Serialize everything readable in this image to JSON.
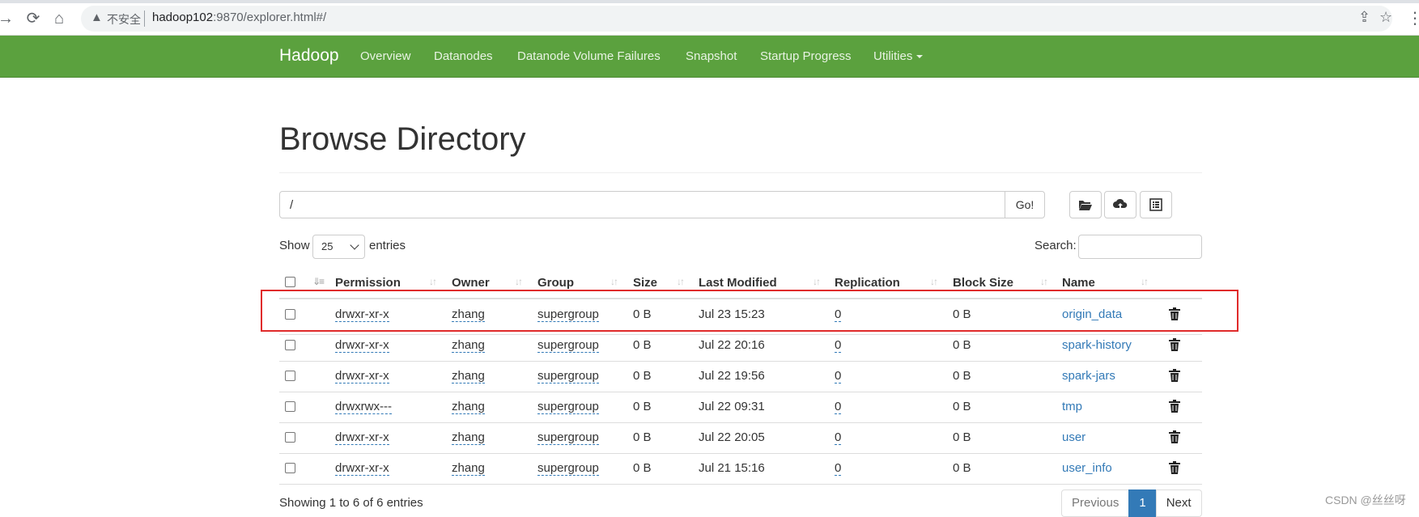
{
  "browser": {
    "insecure_label": "不安全",
    "url_host": "hadoop102",
    "url_rest": ":9870/explorer.html#/"
  },
  "navbar": {
    "brand": "Hadoop",
    "links": [
      "Overview",
      "Datanodes",
      "Datanode Volume Failures",
      "Snapshot",
      "Startup Progress",
      "Utilities"
    ]
  },
  "page": {
    "title": "Browse Directory",
    "path_value": "/",
    "go_label": "Go!",
    "show_label": "Show",
    "page_length": "25",
    "entries_label": "entries",
    "search_label": "Search:",
    "search_value": ""
  },
  "table": {
    "headers": [
      "Permission",
      "Owner",
      "Group",
      "Size",
      "Last Modified",
      "Replication",
      "Block Size",
      "Name"
    ],
    "rows": [
      {
        "permission": "drwxr-xr-x",
        "owner": "zhang",
        "group": "supergroup",
        "size": "0 B",
        "modified": "Jul 23 15:23",
        "replication": "0",
        "block_size": "0 B",
        "name": "origin_data"
      },
      {
        "permission": "drwxr-xr-x",
        "owner": "zhang",
        "group": "supergroup",
        "size": "0 B",
        "modified": "Jul 22 20:16",
        "replication": "0",
        "block_size": "0 B",
        "name": "spark-history"
      },
      {
        "permission": "drwxr-xr-x",
        "owner": "zhang",
        "group": "supergroup",
        "size": "0 B",
        "modified": "Jul 22 19:56",
        "replication": "0",
        "block_size": "0 B",
        "name": "spark-jars"
      },
      {
        "permission": "drwxrwx---",
        "owner": "zhang",
        "group": "supergroup",
        "size": "0 B",
        "modified": "Jul 22 09:31",
        "replication": "0",
        "block_size": "0 B",
        "name": "tmp"
      },
      {
        "permission": "drwxr-xr-x",
        "owner": "zhang",
        "group": "supergroup",
        "size": "0 B",
        "modified": "Jul 22 20:05",
        "replication": "0",
        "block_size": "0 B",
        "name": "user"
      },
      {
        "permission": "drwxr-xr-x",
        "owner": "zhang",
        "group": "supergroup",
        "size": "0 B",
        "modified": "Jul 21 15:16",
        "replication": "0",
        "block_size": "0 B",
        "name": "user_info"
      }
    ],
    "info": "Showing 1 to 6 of 6 entries"
  },
  "pagination": {
    "previous": "Previous",
    "current": "1",
    "next": "Next"
  },
  "watermark": "CSDN @丝丝呀",
  "colors": {
    "navbar": "#5ba13e",
    "link": "#337ab7",
    "highlight": "#e02b2b"
  }
}
